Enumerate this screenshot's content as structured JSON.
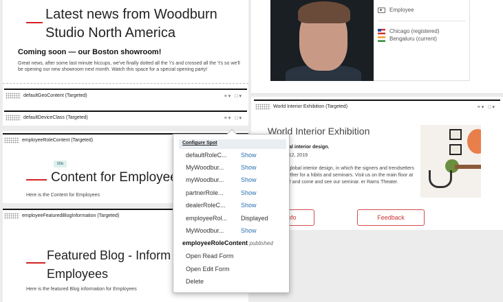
{
  "news": {
    "title": "Latest news from Woodburn Studio North America",
    "subtitle": "Coming soon — our Boston showroom!",
    "body": "Great news, after some last minute hiccups, we've finally dotted all the 'i's and crossed all the 't's so we'll be opening our new showroom next month. Watch this space for a special opening party!"
  },
  "bars": {
    "geo": "defaultGeoContent (Targeted)",
    "device": "defaultDeviceClass (Targeted)",
    "role": "employeeRoleContent (Targeted)",
    "blog": "employeeFeaturedBlogInformation (Targeted)",
    "exhibition": "World Interior Exhibition (Targeted)",
    "controls": "≡▾ □▾"
  },
  "role": {
    "badge": "title",
    "heading": "Content for Employee",
    "body": "Here is the Content for Employees"
  },
  "blog": {
    "heading": "Featured Blog - Inform... Employees",
    "heading_line1": "Featured Blog - Inform",
    "heading_line2": "Employees",
    "body": "Here is the featured Blog information for Employees"
  },
  "profile": {
    "role": "Employee",
    "location_registered": "Chicago (registered)",
    "location_current": "Bengaluru (current)"
  },
  "exhibition": {
    "title": "World Interior Exhibition",
    "subtitle": "le of global interior design.",
    "date": "Doe, Feb 12, 2019",
    "body": "nnacle of global interior design, in which the signers and trendsetters come together for a hibits and seminars. Visit us on the main floor at area A.012 and come and see our seminar. er Rams Theater.",
    "info_button": "Info",
    "feedback_button": "Feedback"
  },
  "popup": {
    "header": "Configure Spot",
    "rows": [
      {
        "name": "defaultRoleC...",
        "action": "Show"
      },
      {
        "name": "MyWoodbur...",
        "action": "Show"
      },
      {
        "name": "myWoodbur...",
        "action": "Show"
      },
      {
        "name": "partnerRole...",
        "action": "Show"
      },
      {
        "name": "dealerRoleC...",
        "action": "Show"
      },
      {
        "name": "employeeRol...",
        "action": "Displayed"
      },
      {
        "name": "MyWoodbur...",
        "action": "Show"
      }
    ],
    "current_name": "employeeRoleContent",
    "current_status": "published",
    "actions": [
      "Open Read Form",
      "Open Edit Form",
      "Delete"
    ]
  },
  "colors": {
    "accent_red": "#d32222",
    "link_blue": "#2a6fb0",
    "badge_bg": "#dff0ee"
  }
}
